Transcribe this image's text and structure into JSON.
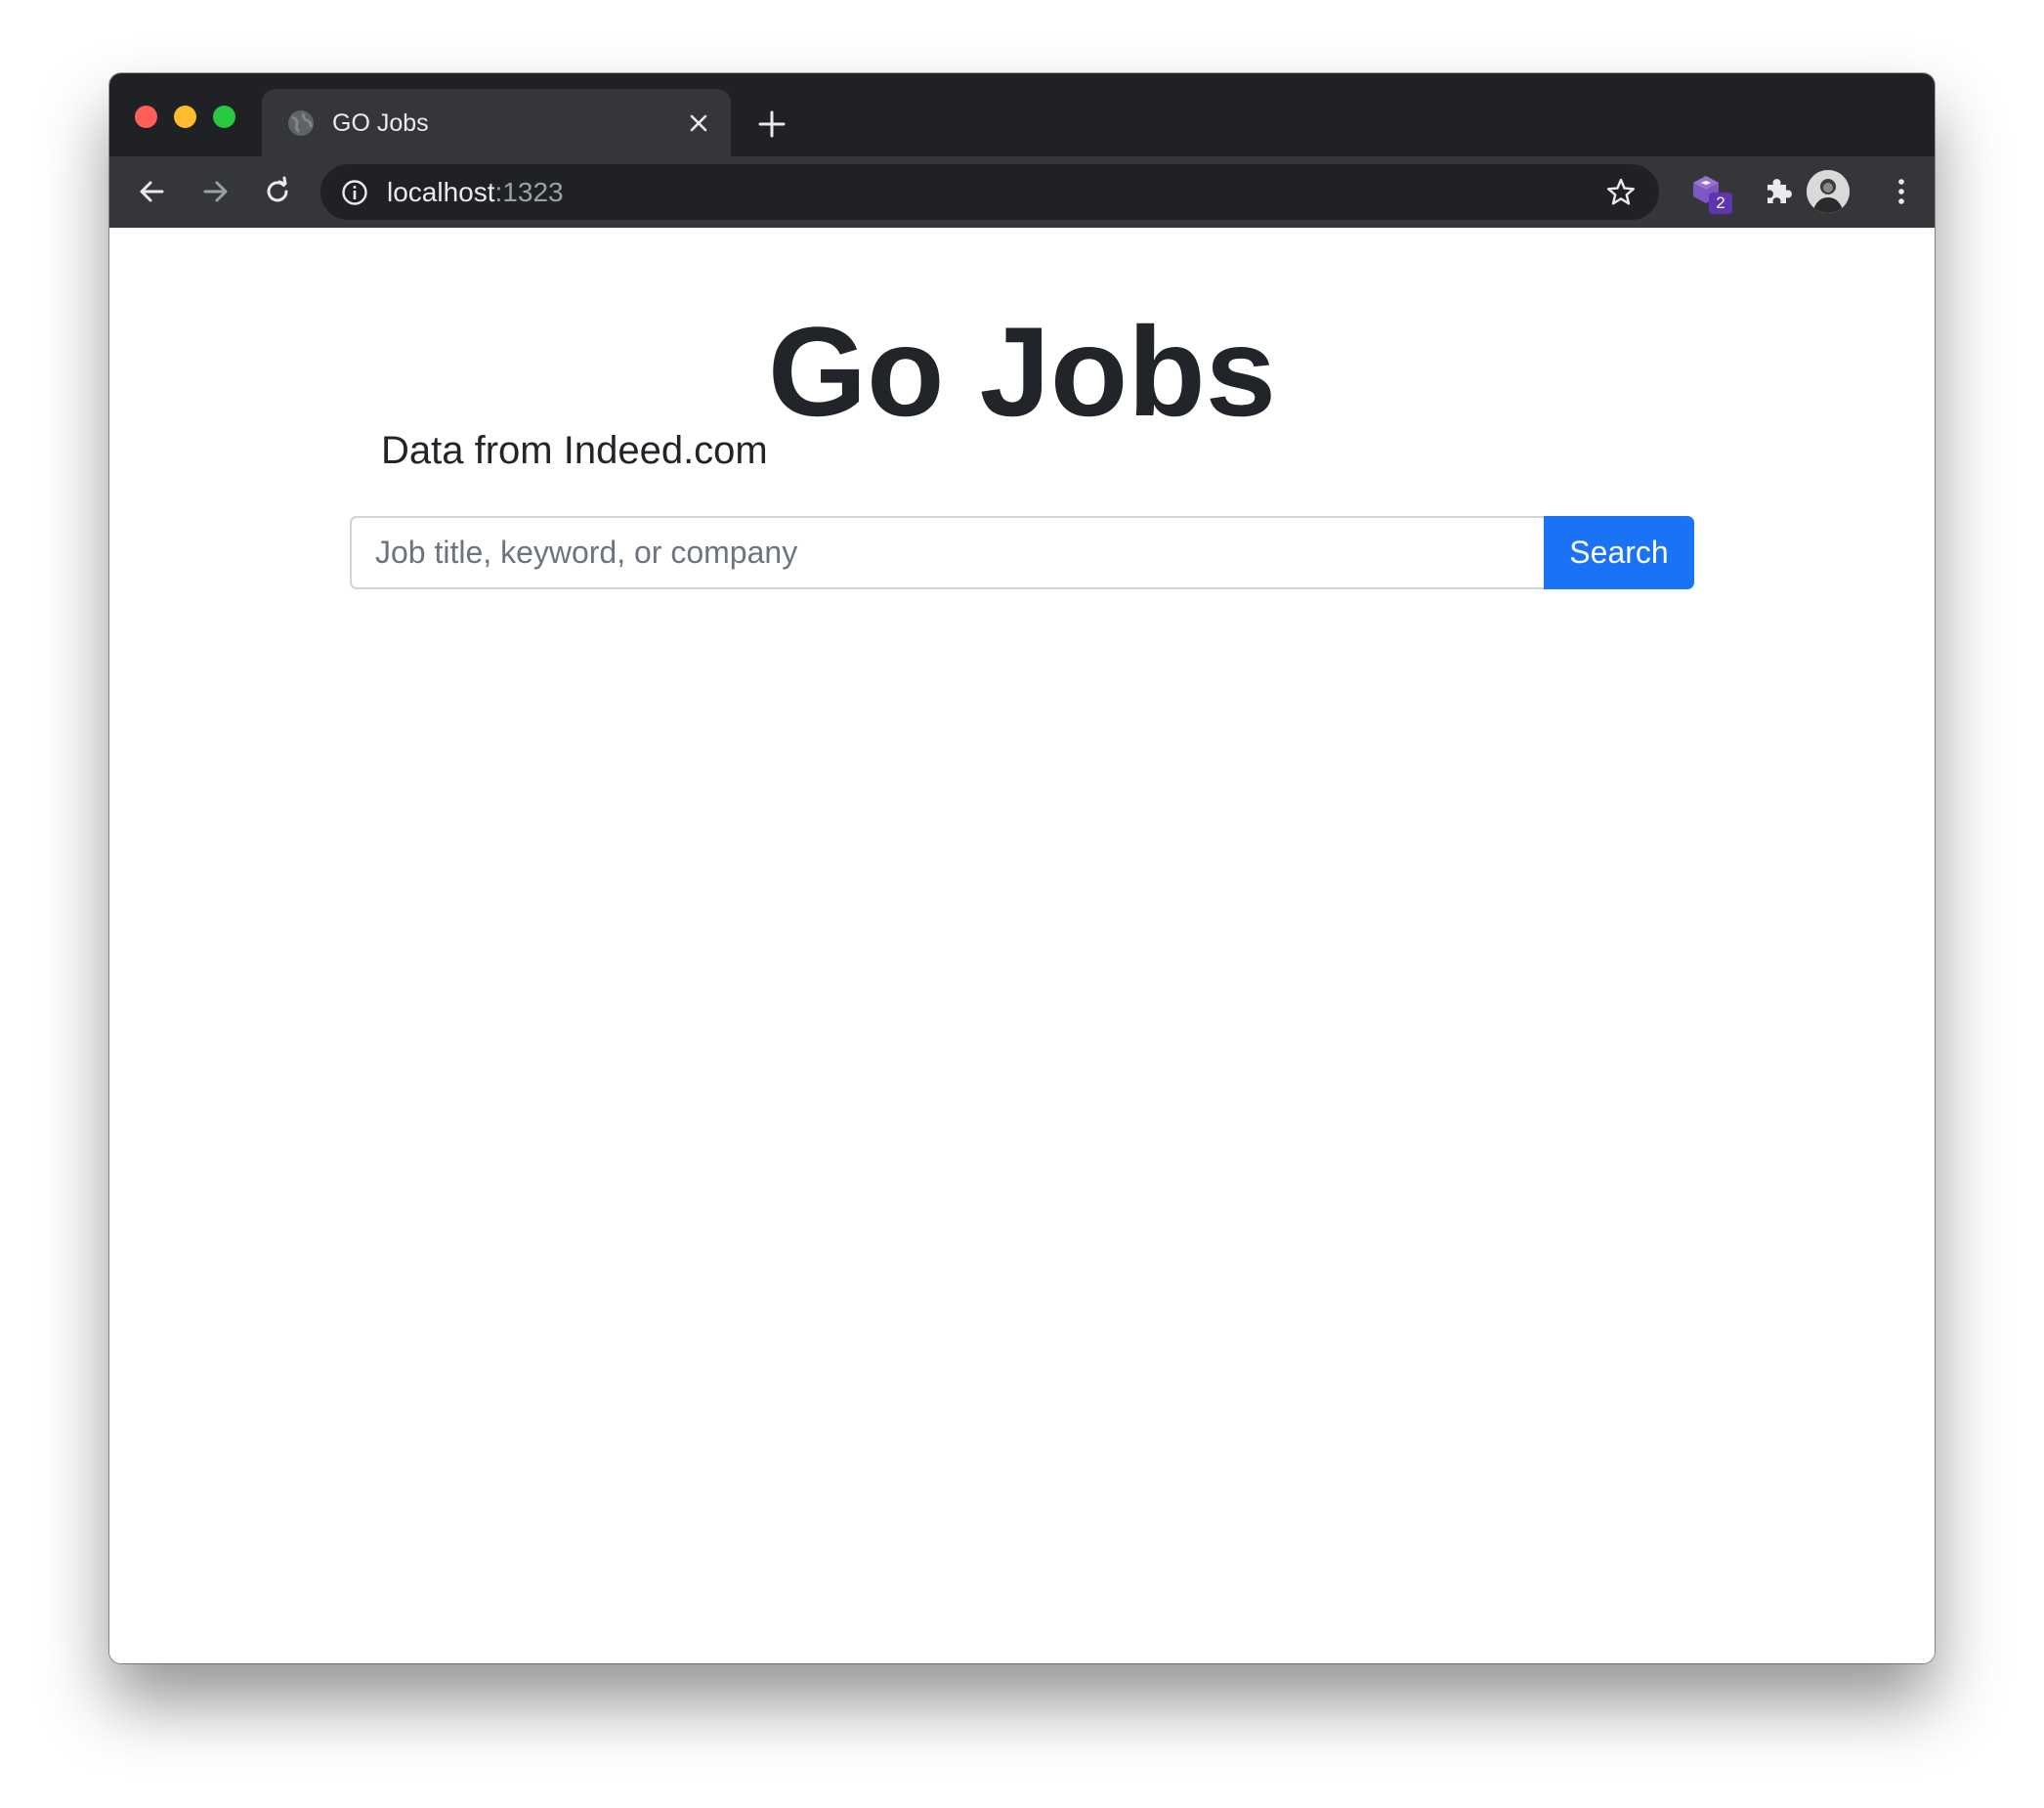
{
  "browser": {
    "tab": {
      "title": "GO Jobs"
    },
    "address_bar": {
      "host": "localhost",
      "port": ":1323"
    },
    "extension_badge_count": "2",
    "icons": {
      "favicon": "globe-icon",
      "tab_close": "close-icon",
      "new_tab": "plus-icon",
      "back": "arrow-left-icon",
      "forward": "arrow-right-icon",
      "reload": "reload-icon",
      "site_info": "info-icon",
      "bookmark": "star-icon",
      "extensions": "puzzle-icon",
      "menu": "kebab-menu-icon"
    },
    "colors": {
      "tabstrip_bg": "#202124",
      "toolbar_bg": "#35363a",
      "traffic_red": "#ff5f57",
      "traffic_yellow": "#febc2e",
      "traffic_green": "#28c840"
    }
  },
  "page": {
    "title": "Go Jobs",
    "subtitle": "Data from Indeed.com",
    "search": {
      "placeholder": "Job title, keyword, or company",
      "value": "",
      "button_label": "Search"
    },
    "colors": {
      "primary_button": "#1a73f5",
      "text": "#212529"
    }
  }
}
